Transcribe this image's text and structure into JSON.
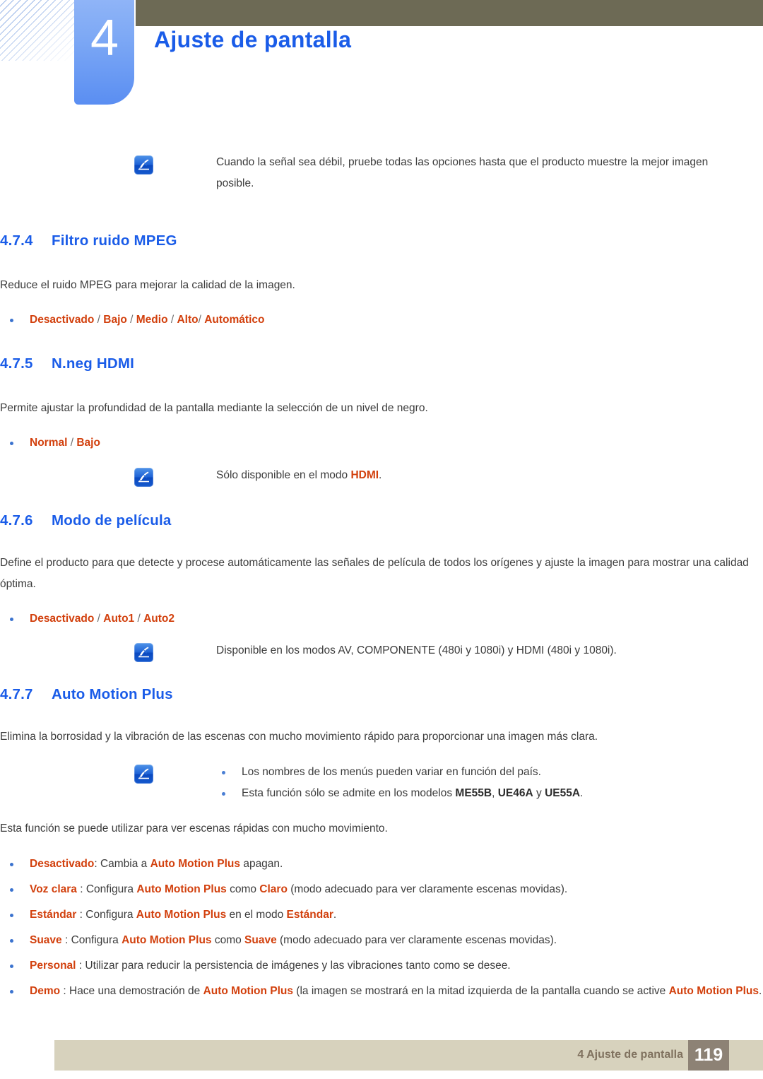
{
  "header": {
    "chapter_number": "4",
    "chapter_title": "Ajuste de pantalla"
  },
  "notes": {
    "weak_signal": "Cuando la señal sea débil, pruebe todas las opciones hasta que el producto muestre la mejor imagen posible.",
    "hdmi_only_prefix": "Sólo disponible en el modo ",
    "hdmi_only_term": "HDMI",
    "hdmi_only_suffix": ".",
    "film_modes": "Disponible en los modos AV, COMPONENTE (480i y 1080i) y HDMI (480i y 1080i).",
    "amp_note_1": "Los nombres de los menús pueden variar en función del país.",
    "amp_note_2_pre": "Esta función sólo se admite en los modelos ",
    "amp_note_2_m1": "ME55B",
    "amp_note_2_sep1": ", ",
    "amp_note_2_m2": "UE46A",
    "amp_note_2_sep2": " y ",
    "amp_note_2_m3": "UE55A",
    "amp_note_2_end": "."
  },
  "sections": [
    {
      "number": "4.7.4",
      "title": "Filtro ruido MPEG",
      "description": "Reduce el ruido MPEG para mejorar la calidad de la imagen.",
      "options": [
        "Desactivado",
        "Bajo",
        "Medio",
        "Alto",
        "Automático"
      ]
    },
    {
      "number": "4.7.5",
      "title": "N.neg HDMI",
      "description": "Permite ajustar la profundidad de la pantalla mediante la selección de un nivel de negro.",
      "options": [
        "Normal",
        "Bajo"
      ]
    },
    {
      "number": "4.7.6",
      "title": "Modo de película",
      "description": "Define el producto para que detecte y procese automáticamente las señales de película de todos los orígenes y ajuste la imagen para mostrar una calidad óptima.",
      "options": [
        "Desactivado",
        "Auto1",
        "Auto2"
      ]
    },
    {
      "number": "4.7.7",
      "title": "Auto Motion Plus",
      "description": "Elimina la borrosidad y la vibración de las escenas con mucho movimiento rápido para proporcionar una imagen más clara.",
      "intro2": "Esta función se puede utilizar para ver escenas rápidas con mucho movimiento."
    }
  ],
  "amp_terms": {
    "auto_motion_plus": "Auto Motion Plus"
  },
  "amp_items": [
    {
      "term": "Desactivado",
      "after_term": ": Cambia a ",
      "mid_term": "Auto Motion Plus",
      "tail": " apagan."
    },
    {
      "term": "Voz clara",
      "after_term": " : Configura ",
      "mid_term": "Auto Motion Plus",
      "mid_text": " como ",
      "mid_term2": "Claro",
      "tail": " (modo adecuado para ver claramente escenas movidas)."
    },
    {
      "term": "Estándar",
      "after_term": " : Configura ",
      "mid_term": "Auto Motion Plus",
      "mid_text": " en el modo ",
      "mid_term2": "Estándar",
      "tail": "."
    },
    {
      "term": "Suave",
      "after_term": " : Configura ",
      "mid_term": "Auto Motion Plus",
      "mid_text": " como ",
      "mid_term2": "Suave",
      "tail": " (modo adecuado para ver claramente escenas movidas)."
    },
    {
      "term": "Personal",
      "after_term": " : Utilizar para reducir la persistencia de imágenes y las vibraciones tanto como se desee.",
      "mid_term": "",
      "mid_text": "",
      "mid_term2": "",
      "tail": ""
    },
    {
      "term": "Demo",
      "after_term": " : Hace una demostración de ",
      "mid_term": "Auto Motion Plus",
      "mid_text": " (la imagen se mostrará en la mitad izquierda de la pantalla cuando se active ",
      "mid_term2": "Auto Motion Plus",
      "tail": "."
    }
  ],
  "footer": {
    "label": "4 Ajuste de pantalla",
    "page": "119"
  },
  "colors": {
    "heading_blue": "#1a5ce8",
    "highlight_orange": "#d2400d",
    "olive_bar": "#6d6a55",
    "footer_bar": "#d7d2bd",
    "footer_page_box": "#8d8275"
  }
}
